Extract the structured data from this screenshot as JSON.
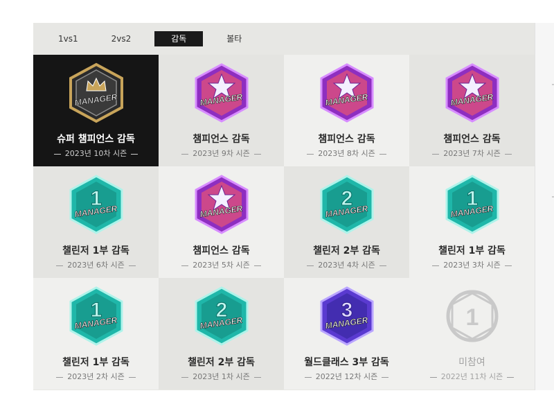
{
  "tabs": [
    {
      "label": "1vs1"
    },
    {
      "label": "2vs2"
    },
    {
      "label": "감독"
    },
    {
      "label": "볼타"
    }
  ],
  "active_tab": "감독",
  "badge_text": "MANAGER",
  "colors": {
    "black_badge": "#1b1b1b",
    "purple_badge": "#8e2ec0",
    "teal_badge": "#1fb7a9",
    "violet_badge": "#5a3ad0",
    "gray_badge": "#c9c9c9",
    "gold": "#c8a45a",
    "active_tab_bg": "#1a1a1a"
  },
  "cells": [
    {
      "title": "슈퍼 챔피언스 감독",
      "season": "2023년 10차 시즌",
      "badge": "super-champions",
      "numeral": ""
    },
    {
      "title": "챔피언스 감독",
      "season": "2023년 9차 시즌",
      "badge": "champions",
      "numeral": ""
    },
    {
      "title": "챔피언스 감독",
      "season": "2023년 8차 시즌",
      "badge": "champions",
      "numeral": ""
    },
    {
      "title": "챔피언스 감독",
      "season": "2023년 7차 시즌",
      "badge": "champions",
      "numeral": ""
    },
    {
      "title": "챌린저 1부 감독",
      "season": "2023년 6차 시즌",
      "badge": "challenger",
      "numeral": "1"
    },
    {
      "title": "챔피언스 감독",
      "season": "2023년 5차 시즌",
      "badge": "champions",
      "numeral": ""
    },
    {
      "title": "챌린저 2부 감독",
      "season": "2023년 4차 시즌",
      "badge": "challenger",
      "numeral": "2"
    },
    {
      "title": "챌린저 1부 감독",
      "season": "2023년 3차 시즌",
      "badge": "challenger",
      "numeral": "1"
    },
    {
      "title": "챌린저 1부 감독",
      "season": "2023년 2차 시즌",
      "badge": "challenger",
      "numeral": "1"
    },
    {
      "title": "챌린저 2부 감독",
      "season": "2023년 1차 시즌",
      "badge": "challenger",
      "numeral": "2"
    },
    {
      "title": "월드클래스 3부 감독",
      "season": "2022년 12차 시즌",
      "badge": "world-class",
      "numeral": "3"
    },
    {
      "title": "미참여",
      "season": "2022년 11차 시즌",
      "badge": "not-participated",
      "numeral": "1"
    }
  ]
}
